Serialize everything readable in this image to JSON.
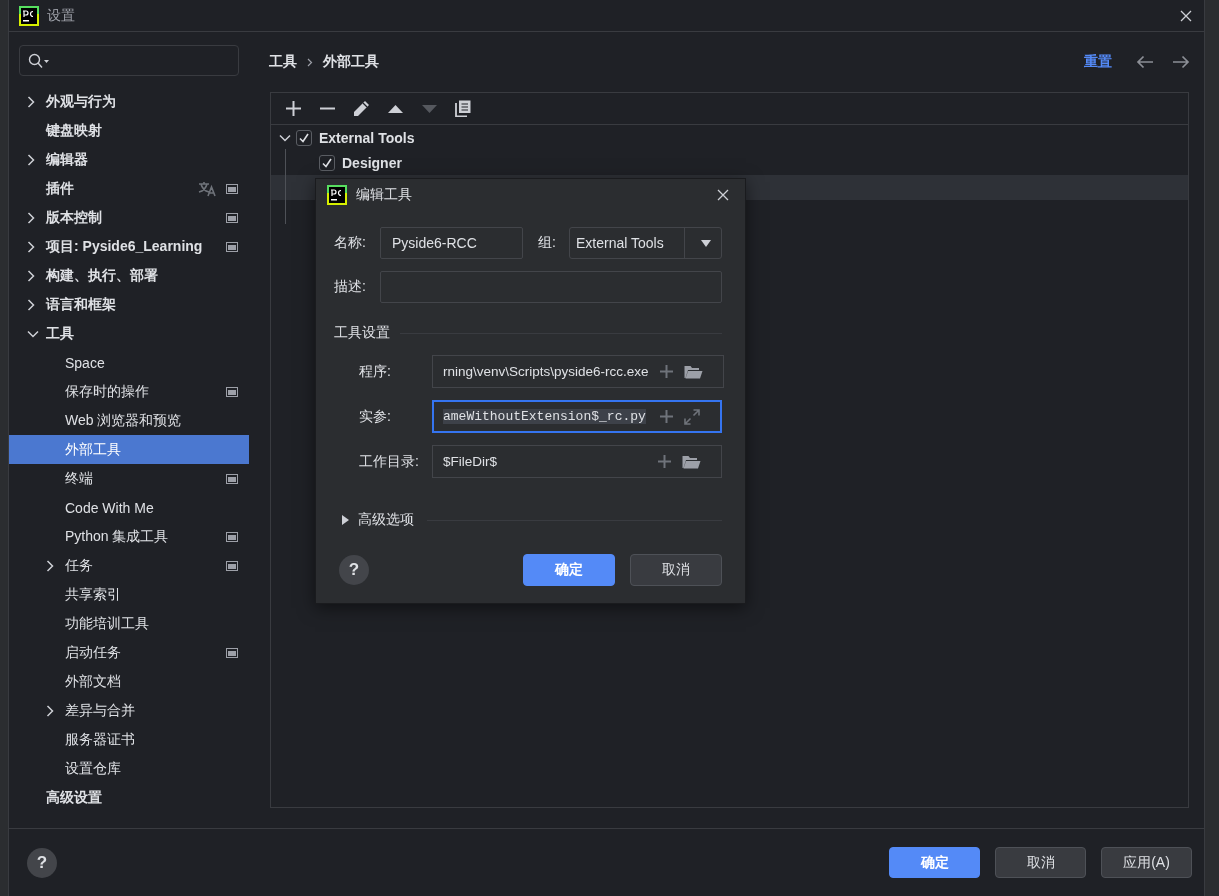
{
  "window": {
    "title": "设置"
  },
  "sidebar": {
    "items": [
      {
        "label": "外观与行为",
        "expanded": false,
        "selected": false,
        "scope_icon": false
      },
      {
        "label": "键盘映射",
        "selected": false,
        "scope_icon": false
      },
      {
        "label": "编辑器",
        "expanded": false,
        "selected": false,
        "scope_icon": false
      },
      {
        "label": "插件",
        "selected": false,
        "scope_icon": true,
        "translate_icon": true
      },
      {
        "label": "版本控制",
        "expanded": false,
        "selected": false,
        "scope_icon": true
      },
      {
        "label": "项目: Pyside6_Learning",
        "expanded": false,
        "selected": false,
        "scope_icon": true
      },
      {
        "label": "构建、执行、部署",
        "expanded": false,
        "selected": false,
        "scope_icon": false
      },
      {
        "label": "语言和框架",
        "expanded": false,
        "selected": false,
        "scope_icon": false
      },
      {
        "label": "工具",
        "expanded": true,
        "selected": false,
        "scope_icon": false,
        "children": [
          {
            "label": "Space",
            "selected": false,
            "scope_icon": false
          },
          {
            "label": "保存时的操作",
            "selected": false,
            "scope_icon": true
          },
          {
            "label": "Web 浏览器和预览",
            "selected": false,
            "scope_icon": false
          },
          {
            "label": "外部工具",
            "selected": true,
            "scope_icon": false
          },
          {
            "label": "终端",
            "selected": false,
            "scope_icon": true
          },
          {
            "label": "Code With Me",
            "selected": false,
            "scope_icon": false
          },
          {
            "label": "Python 集成工具",
            "selected": false,
            "scope_icon": true
          },
          {
            "label": "任务",
            "expanded": false,
            "selected": false,
            "scope_icon": true
          },
          {
            "label": "共享索引",
            "selected": false,
            "scope_icon": false
          },
          {
            "label": "功能培训工具",
            "selected": false,
            "scope_icon": false
          },
          {
            "label": "启动任务",
            "selected": false,
            "scope_icon": true
          },
          {
            "label": "外部文档",
            "selected": false,
            "scope_icon": false
          },
          {
            "label": "差异与合并",
            "expanded": false,
            "selected": false,
            "scope_icon": false
          },
          {
            "label": "服务器证书",
            "selected": false,
            "scope_icon": false
          },
          {
            "label": "设置仓库",
            "selected": false,
            "scope_icon": false
          }
        ]
      },
      {
        "label": "高级设置",
        "selected": false,
        "scope_icon": false
      }
    ]
  },
  "breadcrumb": [
    "工具",
    "外部工具"
  ],
  "header": {
    "reset_link": "重置"
  },
  "toolbar": {
    "buttons": [
      {
        "kind": "add",
        "disabled": false
      },
      {
        "kind": "remove",
        "disabled": false
      },
      {
        "kind": "edit",
        "disabled": false
      },
      {
        "kind": "move-up",
        "disabled": false
      },
      {
        "kind": "move-down",
        "disabled": true
      },
      {
        "kind": "copy",
        "disabled": false
      }
    ]
  },
  "tools_tree": {
    "items": [
      {
        "label": "External Tools",
        "checked": true,
        "expanded": true,
        "selected": false,
        "children": [
          {
            "label": "Designer",
            "checked": true,
            "selected": false
          },
          {
            "selected": true
          }
        ]
      }
    ]
  },
  "dialog": {
    "title": "编辑工具",
    "name": {
      "label": "名称:",
      "value": "Pyside6-RCC"
    },
    "group": {
      "label": "组:",
      "value": "External Tools"
    },
    "description": {
      "label": "描述:"
    },
    "section_title": "工具设置",
    "fields": [
      {
        "label": "程序:",
        "value": "rning\\venv\\Scripts\\pyside6-rcc.exe",
        "kind": "browse",
        "focused": false,
        "text_selected": false
      },
      {
        "label": "实参:",
        "value": "ameWithoutExtension$_rc.py",
        "kind": "expand",
        "focused": true,
        "text_selected": true
      },
      {
        "label": "工作目录:",
        "value": "$FileDir$",
        "kind": "browse",
        "focused": false,
        "text_selected": false
      }
    ],
    "advanced": {
      "label": "高级选项",
      "expanded": false
    },
    "help_label": "?",
    "ok_button": "确定",
    "cancel_button": "取消"
  },
  "footer": {
    "help_label": "?",
    "buttons": [
      {
        "label": "确定",
        "primary": true
      },
      {
        "label": "取消",
        "primary": false
      },
      {
        "label": "应用(A)",
        "primary": false
      }
    ]
  }
}
